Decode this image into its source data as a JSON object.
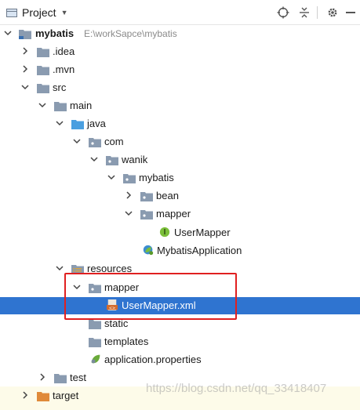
{
  "header": {
    "title": "Project",
    "view_dropdown_icon": "triangle-down-icon",
    "tools": [
      "target-icon",
      "collapse-icon",
      "gear-icon",
      "hide-icon"
    ]
  },
  "colors": {
    "selection": "#2f74d0",
    "highlight_box": "#e02020",
    "folder": "#8a9bb0",
    "source_folder": "#4a9fe0",
    "resource_folder": "#d9a441"
  },
  "tree": {
    "root_label": "mybatis",
    "root_path": "E:\\workSapce\\mybatis",
    "idea": ".idea",
    "mvn": ".mvn",
    "src": "src",
    "main": "main",
    "java": "java",
    "com": "com",
    "wanik": "wanik",
    "mybatis_pkg": "mybatis",
    "bean": "bean",
    "mapper_pkg": "mapper",
    "usermapper": "UserMapper",
    "usermapper_badge": "I",
    "app": "MybatisApplication",
    "resources": "resources",
    "res_mapper": "mapper",
    "xml": "UserMapper.xml",
    "static": "static",
    "templates": "templates",
    "props": "application.properties",
    "test": "test",
    "target": "target"
  },
  "watermark": "https://blog.csdn.net/qq_33418407"
}
